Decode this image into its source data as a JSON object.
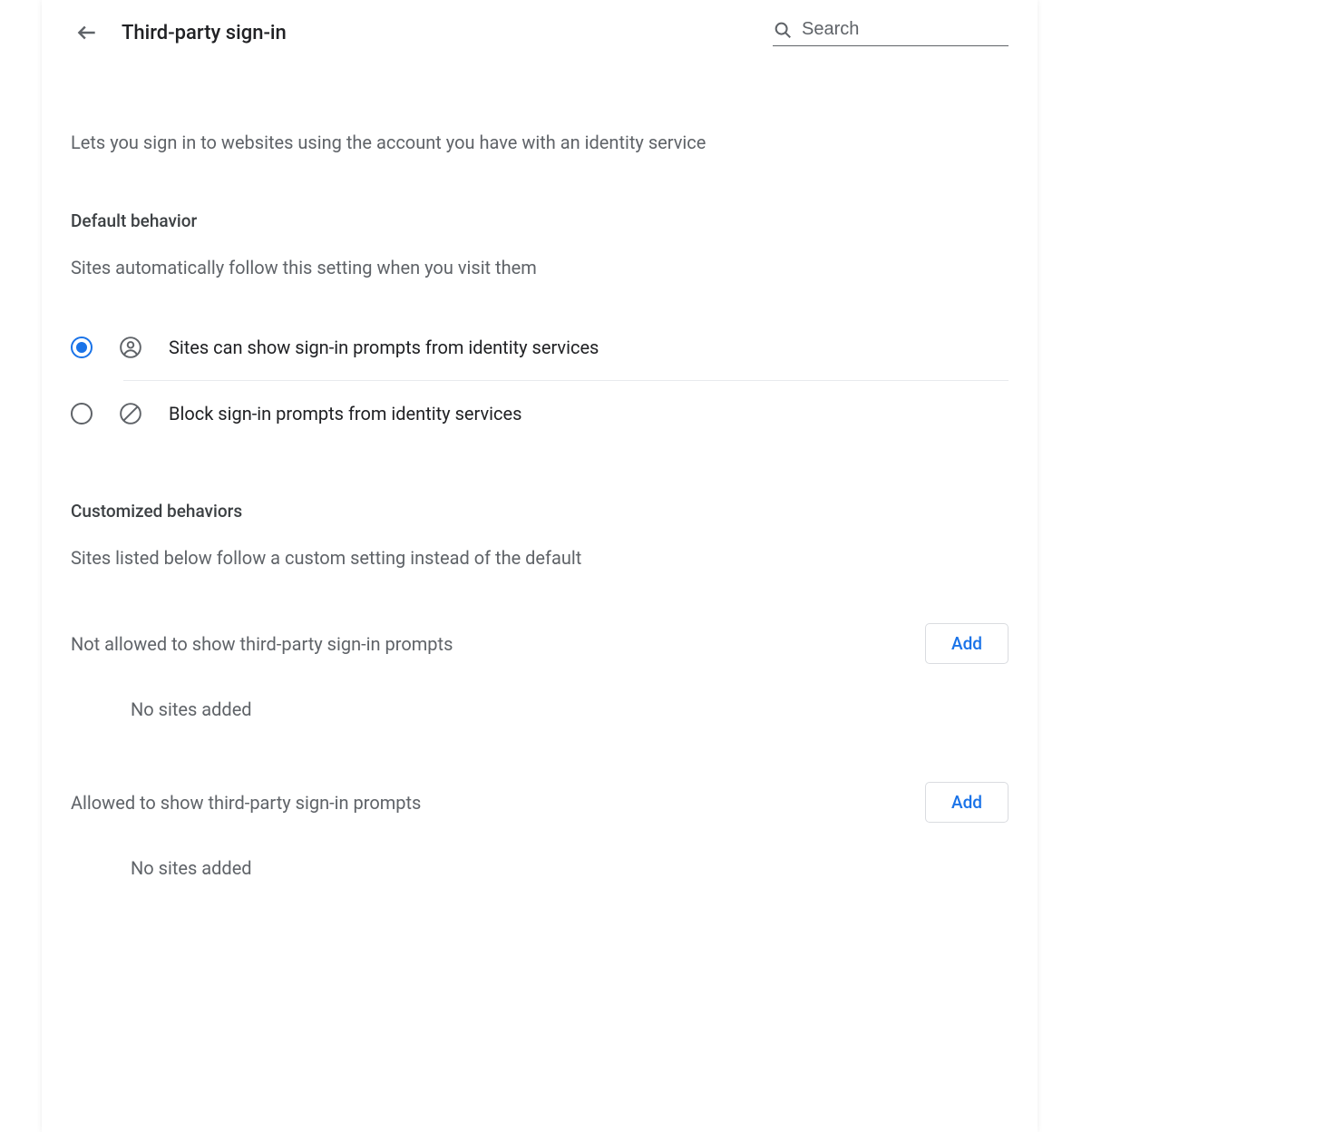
{
  "header": {
    "title": "Third-party sign-in",
    "search_placeholder": "Search"
  },
  "description": "Lets you sign in to websites using the account you have with an identity service",
  "default_behavior": {
    "title": "Default behavior",
    "subtitle": "Sites automatically follow this setting when you visit them",
    "options": [
      {
        "label": "Sites can show sign-in prompts from identity services",
        "selected": true,
        "icon": "person-circle-icon"
      },
      {
        "label": "Block sign-in prompts from identity services",
        "selected": false,
        "icon": "block-icon"
      }
    ]
  },
  "customized_behaviors": {
    "title": "Customized behaviors",
    "subtitle": "Sites listed below follow a custom setting instead of the default",
    "sections": [
      {
        "label": "Not allowed to show third-party sign-in prompts",
        "add_label": "Add",
        "empty_text": "No sites added"
      },
      {
        "label": "Allowed to show third-party sign-in prompts",
        "add_label": "Add",
        "empty_text": "No sites added"
      }
    ]
  }
}
